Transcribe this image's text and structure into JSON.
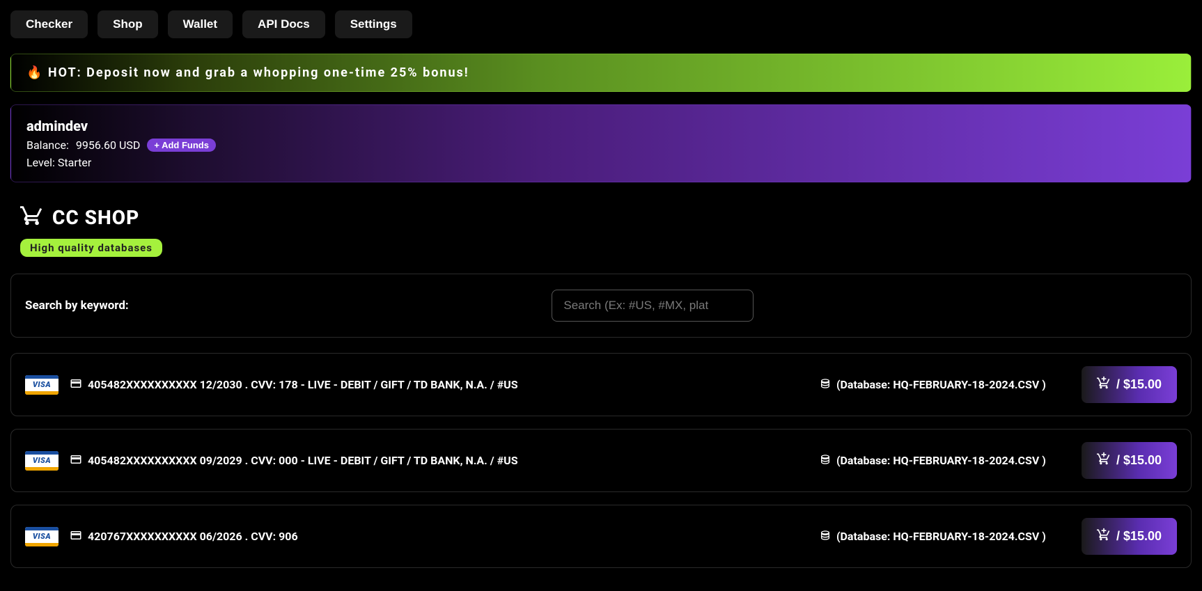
{
  "nav": {
    "tabs": [
      "Checker",
      "Shop",
      "Wallet",
      "API Docs",
      "Settings"
    ]
  },
  "banner_hot": {
    "icon": "🔥",
    "text": "HOT: Deposit now and grab a whopping one-time 25% bonus!"
  },
  "user": {
    "name": "admindev",
    "balance_label": "Balance:",
    "balance_value": "9956.60 USD",
    "add_funds_label": "+ Add Funds",
    "level_label": "Level:",
    "level_value": "Starter"
  },
  "page": {
    "title": "CC SHOP",
    "subtitle": "High quality databases"
  },
  "search": {
    "label": "Search by keyword:",
    "placeholder": "Search (Ex: #US, #MX, plat"
  },
  "listings": [
    {
      "brand": "VISA",
      "card_text": "405482XXXXXXXXXX 12/2030 . CVV: 178 - LIVE - DEBIT / GIFT / TD BANK, N.A. / #US",
      "db_text": "(Database: HQ-FEBRUARY-18-2024.CSV )",
      "price": "/ $15.00"
    },
    {
      "brand": "VISA",
      "card_text": "405482XXXXXXXXXX 09/2029 . CVV: 000 - LIVE - DEBIT / GIFT / TD BANK, N.A. / #US",
      "db_text": "(Database: HQ-FEBRUARY-18-2024.CSV )",
      "price": "/ $15.00"
    },
    {
      "brand": "VISA",
      "card_text": "420767XXXXXXXXXX 06/2026 . CVV: 906",
      "db_text": "(Database: HQ-FEBRUARY-18-2024.CSV )",
      "price": "/ $15.00"
    }
  ]
}
